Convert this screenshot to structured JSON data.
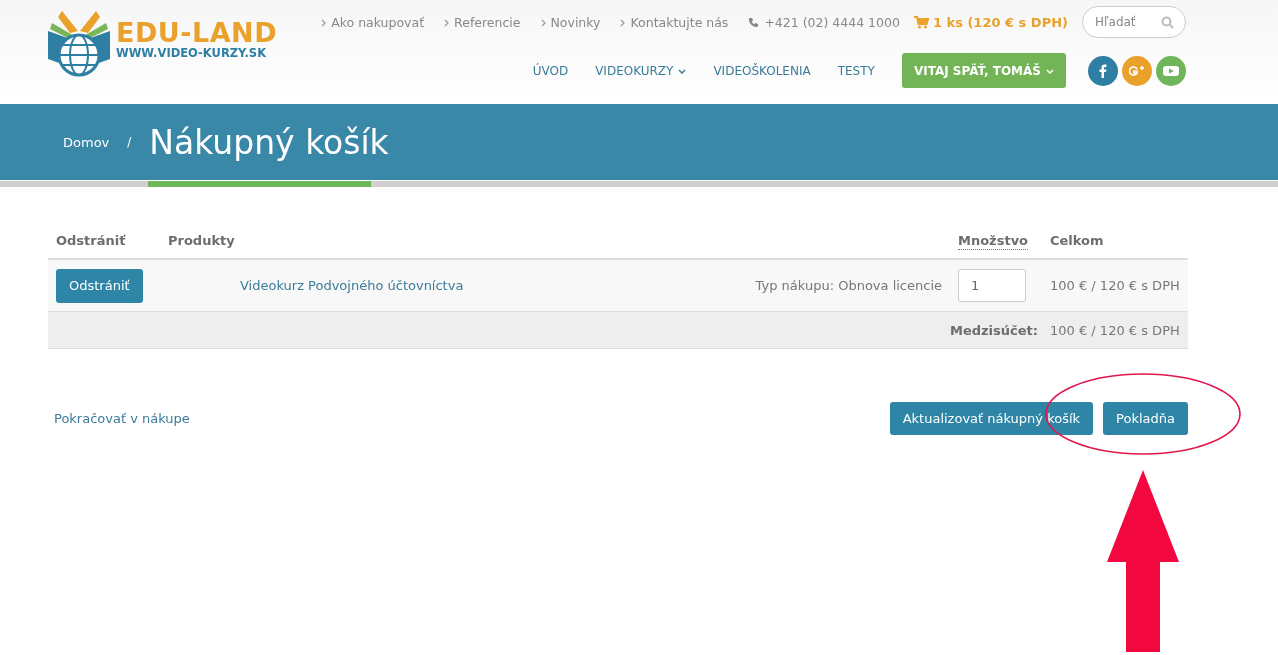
{
  "logo": {
    "title": "EDU-LAND",
    "subtitle": "WWW.VIDEO-KURZY.SK"
  },
  "top_links": [
    {
      "label": "Ako nakupovať"
    },
    {
      "label": "Referencie"
    },
    {
      "label": "Novinky"
    },
    {
      "label": "Kontaktujte nás"
    }
  ],
  "phone": "+421 (02) 4444 1000",
  "cart": "1 ks (120 € s DPH)",
  "search": {
    "placeholder": "Hľadať"
  },
  "nav": [
    {
      "label": "ÚVOD",
      "dropdown": false,
      "kind": "link"
    },
    {
      "label": "VIDEOKURZY",
      "dropdown": true,
      "kind": "link"
    },
    {
      "label": "VIDEOŠKOLENIA",
      "dropdown": false,
      "kind": "link"
    },
    {
      "label": "TESTY",
      "dropdown": false,
      "kind": "link"
    },
    {
      "label": "VITAJ SPÄŤ, TOMÁŠ",
      "dropdown": true,
      "kind": "user"
    }
  ],
  "social": [
    {
      "kind": "facebook",
      "color": "#2e7fa3"
    },
    {
      "kind": "googleplus",
      "color": "#e9a12b"
    },
    {
      "kind": "youtube",
      "color": "#6fb55a"
    }
  ],
  "breadcrumb": "Domov",
  "breadcrumb_separator": "/",
  "page_title": "Nákupný košík",
  "table": {
    "columns": [
      "Odstrániť",
      "Produkty",
      "Množstvo",
      "Celkom"
    ],
    "rows": [
      {
        "remove": "Odstrániť",
        "product": "Videokurz Podvojného účtovníctva",
        "type": "Typ nákupu: Obnova licencie",
        "quantity": "1",
        "total": "100 € / 120 € s DPH"
      }
    ],
    "subtotal_label": "Medzisúčet:",
    "subtotal": "100 € / 120 € s DPH"
  },
  "continue_link": "Pokračovať v nákupe",
  "buttons": [
    "Aktualizovať nákupný košík",
    "Pokladňa"
  ]
}
